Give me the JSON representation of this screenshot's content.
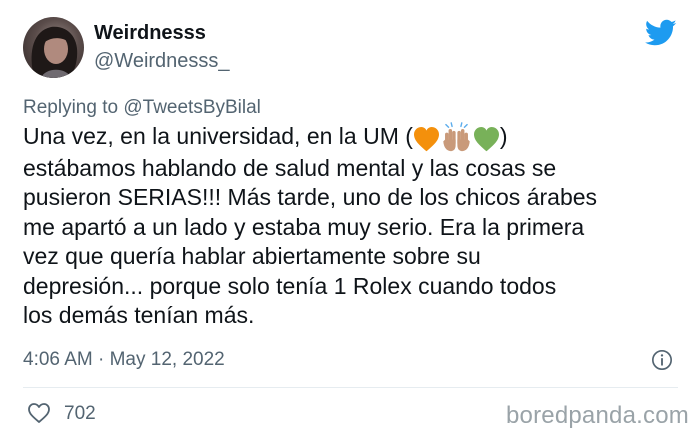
{
  "author": {
    "display_name": "Weirdnesss",
    "handle": "@Weirdnesss_"
  },
  "reply": {
    "prefix": "Replying to",
    "mention": "@TweetsByBilal"
  },
  "tweet": {
    "text_before_emoji": "Una vez, en la universidad, en la UM (",
    "emojis": [
      "orange-heart",
      "raising-hands",
      "green-heart"
    ],
    "text_after_emoji": ")\nestábamos hablando de salud mental y las cosas se\npusieron SERIAS!!! Más tarde, uno de los chicos árabes\nme apartó a un lado y estaba muy serio. Era la primera\nvez que quería hablar abiertamente sobre su\ndepresión... porque solo tenía 1 Rolex cuando todos\nlos demás tenían más."
  },
  "meta": {
    "timestamp": "4:06 AM · May 12, 2022"
  },
  "stats": {
    "likes": "702"
  },
  "watermark": "boredpanda.com",
  "colors": {
    "twitter_blue": "#1d9bf0",
    "secondary_text": "#536471",
    "orange_heart": "#f4900c",
    "green_heart": "#78b159"
  },
  "icons": [
    "twitter-bird-icon",
    "info-icon",
    "heart-outline-icon"
  ]
}
